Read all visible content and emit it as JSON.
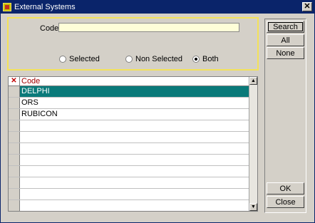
{
  "window": {
    "title": "External Systems",
    "close_glyph": "✕"
  },
  "filter": {
    "code_label": "Code",
    "code_value": "",
    "radios": [
      {
        "label": "Selected",
        "checked": false
      },
      {
        "label": "Non Selected",
        "checked": false
      },
      {
        "label": "Both",
        "checked": true
      }
    ]
  },
  "buttons": {
    "search": "Search",
    "all": "All",
    "none": "None",
    "ok": "OK",
    "close": "Close"
  },
  "grid": {
    "select_header": "✕",
    "code_header": "Code",
    "rows": [
      "DELPHI",
      "ORS",
      "RUBICON",
      "",
      "",
      "",
      "",
      "",
      "",
      "",
      ""
    ],
    "selected_row": 0
  },
  "scroll": {
    "up": "▲",
    "down": "▼"
  },
  "colors": {
    "title_bar": "#0a246a",
    "selected_row": "#0a7a7a",
    "filter_border": "#f3e25a",
    "input_bg": "#fefed8"
  }
}
